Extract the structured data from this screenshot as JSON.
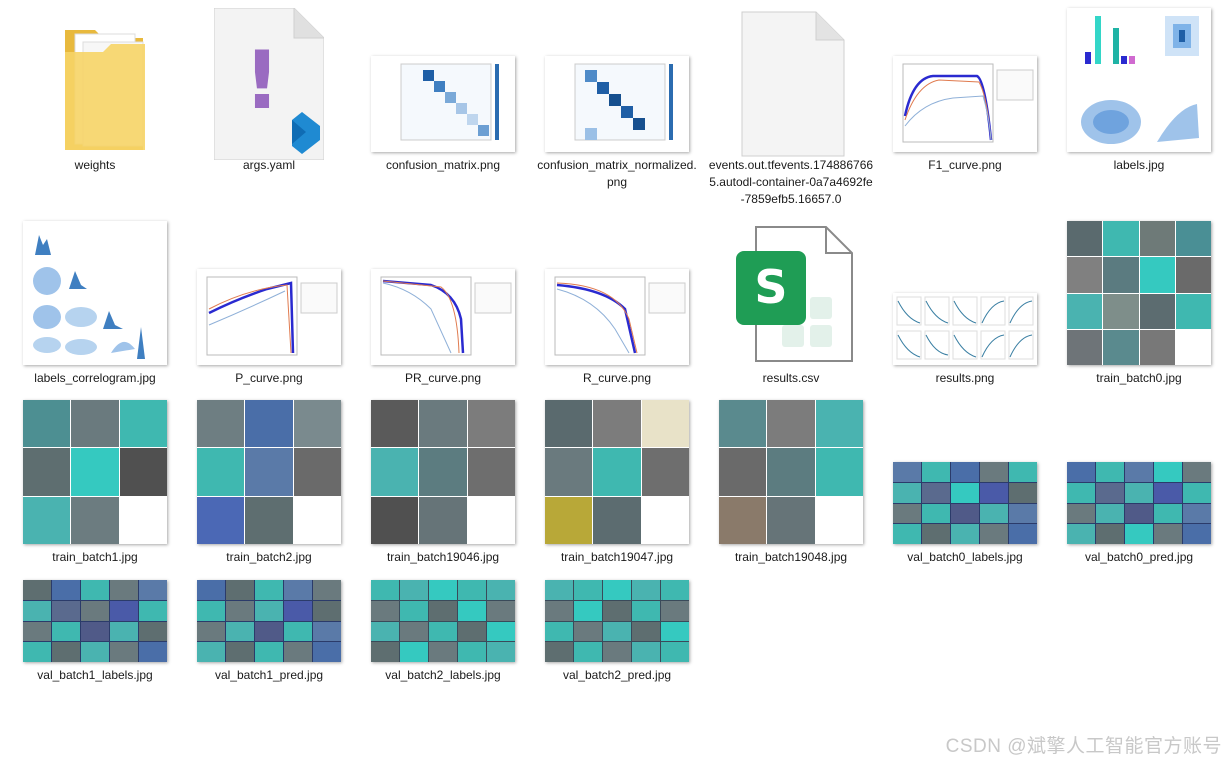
{
  "files": [
    {
      "name": "weights",
      "type": "folder"
    },
    {
      "name": "args.yaml",
      "type": "yaml-doc"
    },
    {
      "name": "confusion_matrix.png",
      "type": "matrix"
    },
    {
      "name": "confusion_matrix_normalized.png",
      "type": "matrix"
    },
    {
      "name": "events.out.tfevents.1748867665.autodl-container-0a7a4692fe-7859efb5.16657.0",
      "type": "blank-doc"
    },
    {
      "name": "F1_curve.png",
      "type": "curve"
    },
    {
      "name": "labels.jpg",
      "type": "labels"
    },
    {
      "name": "labels_correlogram.jpg",
      "type": "correlogram"
    },
    {
      "name": "P_curve.png",
      "type": "curve"
    },
    {
      "name": "PR_curve.png",
      "type": "curve"
    },
    {
      "name": "R_curve.png",
      "type": "curve"
    },
    {
      "name": "results.csv",
      "type": "csv"
    },
    {
      "name": "results.png",
      "type": "results"
    },
    {
      "name": "train_batch0.jpg",
      "type": "collage"
    },
    {
      "name": "train_batch1.jpg",
      "type": "collage"
    },
    {
      "name": "train_batch2.jpg",
      "type": "collage"
    },
    {
      "name": "train_batch19046.jpg",
      "type": "collage"
    },
    {
      "name": "train_batch19047.jpg",
      "type": "collage"
    },
    {
      "name": "train_batch19048.jpg",
      "type": "collage"
    },
    {
      "name": "val_batch0_labels.jpg",
      "type": "val"
    },
    {
      "name": "val_batch0_pred.jpg",
      "type": "val"
    },
    {
      "name": "val_batch1_labels.jpg",
      "type": "val"
    },
    {
      "name": "val_batch1_pred.jpg",
      "type": "val"
    },
    {
      "name": "val_batch2_labels.jpg",
      "type": "val"
    },
    {
      "name": "val_batch2_pred.jpg",
      "type": "val"
    }
  ],
  "csv_icon_letter": "S",
  "yaml_icon_glyph": "!",
  "watermark": "CSDN @斌擎人工智能官方账号",
  "colors": {
    "folder": "#f3c84d",
    "vscode_blue": "#1f8ad2",
    "yaml_purple": "#9a6bc1",
    "csv_green": "#1f9d55",
    "teal_box": "#33d6c8",
    "matrix_blue": "#1f5fa6"
  }
}
